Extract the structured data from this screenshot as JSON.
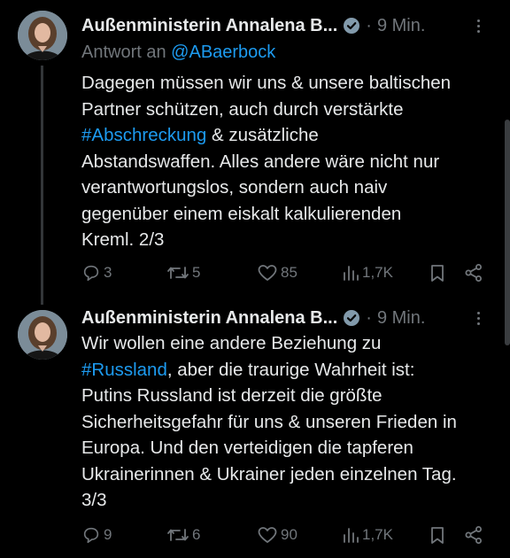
{
  "tweets": [
    {
      "author_name": "Außenministerin Annalena B...",
      "separator": "·",
      "time": "9 Min.",
      "reply_prefix": "Antwort an",
      "reply_handle": "@ABaerbock",
      "lines": [
        {
          "text": "Dagegen müssen wir uns & unsere baltischen"
        },
        {
          "text": "Partner schützen, auch durch verstärkte"
        },
        {
          "hashtag": "#Abschreckung",
          "text": " & zusätzliche"
        },
        {
          "text": "Abstandswaffen. Alles andere wäre nicht nur"
        },
        {
          "text": "verantwortungslos, sondern auch naiv"
        },
        {
          "text": "gegenüber einem eiskalt kalkulierenden"
        },
        {
          "text": "Kreml. 2/3"
        }
      ],
      "stats": {
        "replies": "3",
        "retweets": "5",
        "likes": "85",
        "views": "1,7K"
      }
    },
    {
      "author_name": "Außenministerin Annalena B...",
      "separator": "·",
      "time": "9 Min.",
      "lines": [
        {
          "text": "Wir wollen eine andere Beziehung zu"
        },
        {
          "hashtag": "#Russland",
          "text": ", aber die traurige Wahrheit ist:"
        },
        {
          "text": "Putins Russland ist derzeit die größte"
        },
        {
          "text": "Sicherheitsgefahr für uns & unseren Frieden in"
        },
        {
          "text": "Europa. Und den verteidigen die tapferen"
        },
        {
          "text": "Ukrainerinnen & Ukrainer jeden einzelnen Tag."
        },
        {
          "text": "3/3"
        }
      ],
      "stats": {
        "replies": "9",
        "retweets": "6",
        "likes": "90",
        "views": "1,7K"
      }
    }
  ],
  "icons": {
    "verified": "verified-badge-icon",
    "more": "more-dots-icon",
    "reply": "reply-bubble-icon",
    "retweet": "retweet-icon",
    "like": "heart-icon",
    "views": "views-bars-icon",
    "bookmark": "bookmark-icon",
    "share": "share-icon"
  },
  "colors": {
    "background": "#000000",
    "text": "#e7e9ea",
    "muted": "#71767b",
    "link": "#1d9bf0"
  }
}
